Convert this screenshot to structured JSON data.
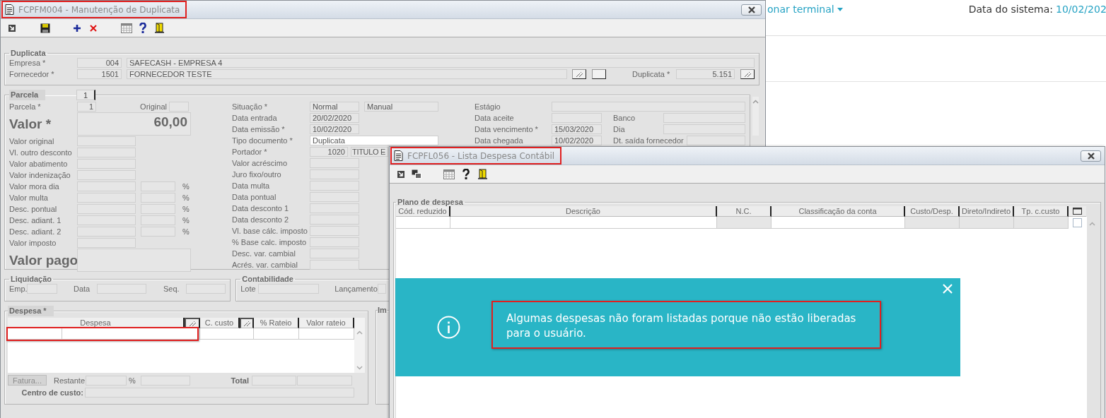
{
  "page_header": {
    "terminal_menu": "onar terminal",
    "system_date_label": "Data do sistema:",
    "system_date": "10/02/202"
  },
  "main_window": {
    "title": "FCPFM004 - Manutenção de Duplicata",
    "title_highlighted": true,
    "duplicata": {
      "legend": "Duplicata",
      "empresa_label": "Empresa *",
      "empresa_code": "004",
      "empresa_name": "SAFECASH -  EMPRESA 4",
      "fornecedor_label": "Fornecedor *",
      "fornecedor_code": "1501",
      "fornecedor_name": "FORNECEDOR TESTE",
      "duplicata_label": "Duplicata *",
      "duplicata_number": "5.151"
    },
    "parcela": {
      "legend": "Parcela",
      "tabs": [
        {
          "label": "1",
          "selected": true
        }
      ],
      "parcela_label": "Parcela *",
      "parcela_value": "1",
      "original_label": "Original",
      "valor_label": "Valor *",
      "valor": "60,00",
      "left_fields": [
        {
          "label": "Valor original"
        },
        {
          "label": "Vl. outro desconto"
        },
        {
          "label": "Valor abatimento"
        },
        {
          "label": "Valor indenização"
        },
        {
          "label": "Valor mora dia",
          "percent": "%"
        },
        {
          "label": "Valor multa",
          "percent": "%"
        },
        {
          "label": "Desc. pontual",
          "percent": "%"
        },
        {
          "label": "Desc. adiant. 1",
          "percent": "%"
        },
        {
          "label": "Desc. adiant. 2",
          "percent": "%"
        },
        {
          "label": "Valor imposto"
        }
      ],
      "valor_pago_label": "Valor pago",
      "middle_fields": [
        {
          "kind": "pair",
          "label": "Situação *",
          "value": "Normal",
          "value_2": "Manual"
        },
        {
          "kind": "plain",
          "label": "Data entrada",
          "value": "20/02/2020"
        },
        {
          "kind": "plain",
          "label": "Data emissão *",
          "value": "10/02/2020"
        },
        {
          "kind": "dropdown",
          "label": "Tipo documento *",
          "value": "Duplicata"
        },
        {
          "kind": "code_name",
          "label": "Portador *",
          "value": "1020",
          "value_2": "TITULO E"
        },
        {
          "kind": "plain",
          "label": "Valor acréscimo"
        },
        {
          "kind": "plain",
          "label": "Juro fixo/outro"
        },
        {
          "kind": "plain",
          "label": "Data multa"
        },
        {
          "kind": "plain",
          "label": "Data pontual"
        },
        {
          "kind": "plain",
          "label": "Data desconto 1"
        },
        {
          "kind": "plain",
          "label": "Data desconto 2"
        },
        {
          "kind": "plain",
          "label": "Vl. base cálc. imposto"
        },
        {
          "kind": "plain",
          "label": "% Base calc. imposto"
        },
        {
          "kind": "plain",
          "label": "Desc. var. cambial"
        },
        {
          "kind": "plain",
          "label": "Acrés. var. cambial"
        }
      ],
      "right_fields": [
        {
          "kind": "wide",
          "label": "Estágio"
        },
        {
          "kind": "side",
          "label": "Data aceite",
          "side_label": "Banco"
        },
        {
          "kind": "side",
          "label": "Data vencimento *",
          "value": "15/03/2020",
          "side_label": "Dia"
        },
        {
          "kind": "side",
          "label": "Data chegada",
          "value": "10/02/2020",
          "side_label": "Dt. saída fornecedor"
        }
      ]
    },
    "liquidacao": {
      "legend": "Liquidação",
      "emp_label": "Emp.",
      "data_label": "Data",
      "seq_label": "Seq."
    },
    "contabilidade": {
      "legend": "Contabilidade",
      "lote_label": "Lote",
      "lancamento_label": "Lançamento"
    },
    "despesa": {
      "legend": "Despesa *",
      "columns": [
        "Despesa",
        "C. custo",
        "% Rateio",
        "Valor rateio"
      ],
      "row_highlighted": true,
      "fatura_button": "Fatura...",
      "fatura_disabled": true,
      "restante_label": "Restante",
      "percent_sign": "%",
      "total_label": "Total",
      "centro_label": "Centro de custo:"
    },
    "side_panel": {
      "legend": "Im"
    }
  },
  "list_window": {
    "title": "FCPFL056 - Lista Despesa Contábil",
    "title_highlighted": true,
    "legend": "Plano de despesa",
    "columns": [
      {
        "label": "Cód. reduzido",
        "editable": true
      },
      {
        "label": "Descrição",
        "editable": true
      },
      {
        "label": "N.C.",
        "editable": false
      },
      {
        "label": "Classificação da conta",
        "editable": true
      },
      {
        "label": "Custo/Desp.",
        "editable": false
      },
      {
        "label": "Direto/Indireto",
        "editable": false
      },
      {
        "label": "Tp. c.custo",
        "editable": false
      }
    ],
    "row_checked": false
  },
  "notification": {
    "message": "Algumas despesas não foram listadas porque não estão liberadas para o usuário.",
    "highlighted": true
  }
}
